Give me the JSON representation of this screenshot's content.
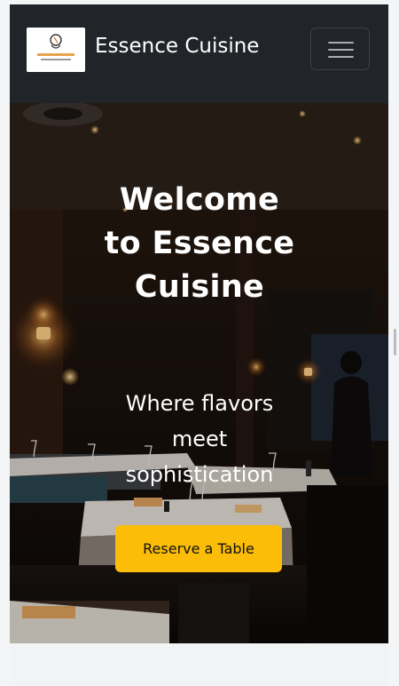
{
  "navbar": {
    "brand": "Essence Cuisine",
    "logo_icon": "restaurant-logo-icon",
    "menu_icon": "hamburger-menu-icon"
  },
  "hero": {
    "title": "Welcome to Essence Cuisine",
    "subtitle": "Where flavors meet sophistication",
    "cta_label": "Reserve a Table"
  },
  "colors": {
    "navbar_bg": "#212429",
    "accent": "#fbbd08",
    "hero_text": "#ffffff",
    "page_bg": "#f2f3f5"
  }
}
